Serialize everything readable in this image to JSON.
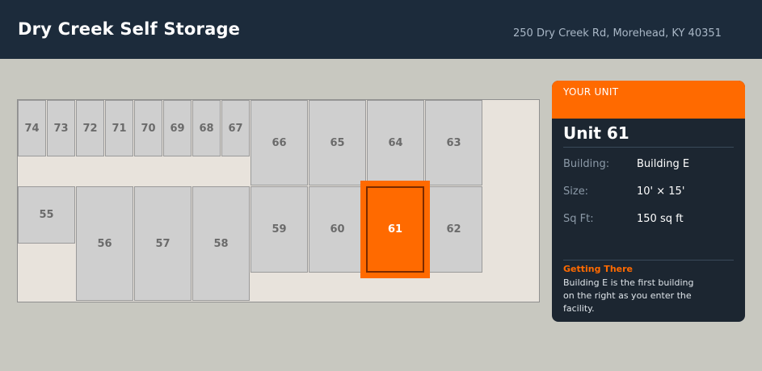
{
  "header": {
    "title": "Dry Creek Self Storage",
    "address": "250 Dry Creek Rd, Morehead, KY 40351"
  },
  "colors": {
    "accent": "#ff6a00",
    "navy": "#1c2b3b",
    "unit": "#cfcfcf"
  },
  "map": {
    "units": [
      "74",
      "73",
      "72",
      "71",
      "70",
      "69",
      "68",
      "67",
      "66",
      "65",
      "64",
      "63",
      "55",
      "56",
      "57",
      "58",
      "59",
      "60",
      "61",
      "62"
    ],
    "selected_unit": "61"
  },
  "card": {
    "kicker": "YOUR UNIT",
    "title": "Unit 61",
    "building_label": "Building:",
    "building_value": "Building E",
    "size_label": "Size:",
    "size_value": "10' × 15'",
    "sqft_label": "Sq Ft:",
    "sqft_value": "150 sq ft",
    "tip_title": "Getting There",
    "tip_text": "Building E is the first building on the right as you enter the facility."
  }
}
